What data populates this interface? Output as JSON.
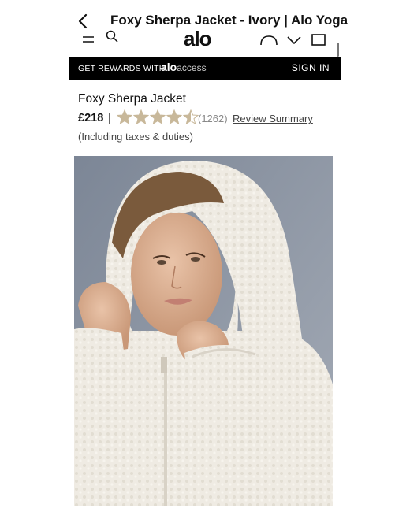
{
  "top_bar": {
    "title": "Foxy Sherpa Jacket - Ivory | Alo Yoga",
    "back_icon": "chevron-left-icon"
  },
  "site_header": {
    "logo": "alo",
    "icons": [
      "menu-icon",
      "search-icon",
      "heart-icon",
      "chevron-down-icon",
      "bag-icon"
    ]
  },
  "rewards_bar": {
    "text": "GET REWARDS WITH",
    "brand_bold": "alo",
    "brand_light": "access",
    "sign_in": "SIGN IN"
  },
  "product": {
    "name": "Foxy Sherpa Jacket",
    "price": "£218",
    "separator": "|",
    "rating": 4.5,
    "rating_max": 5,
    "review_count": "(1262)",
    "review_summary": "Review Summary",
    "tax_note": "(Including taxes & duties)",
    "star_color": "#c8b89a"
  },
  "image": {
    "subject": "model wearing ivory sherpa hooded jacket"
  }
}
